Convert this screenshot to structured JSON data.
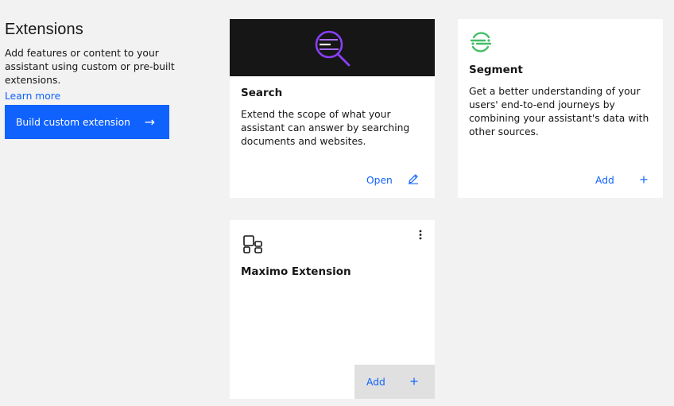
{
  "intro": {
    "title": "Extensions",
    "description": "Add features or content to your assistant using custom or pre-built extensions.",
    "learn_more": "Learn more",
    "build_button": "Build custom extension",
    "build_button_icon": "arrow-right-icon"
  },
  "cards": {
    "search": {
      "title": "Search",
      "description": "Extend the scope of what your assistant can answer by searching documents and websites.",
      "action_label": "Open",
      "action_icon": "edit-icon",
      "icon": "search-magnifier-icon"
    },
    "segment": {
      "title": "Segment",
      "description": "Get a better understanding of your users' end-to-end journeys by combining your assistant's data with other sources.",
      "action_label": "Add",
      "action_icon": "plus-icon",
      "icon": "segment-logo-icon"
    },
    "maximo": {
      "title": "Maximo Extension",
      "action_label": "Add",
      "action_icon": "plus-icon",
      "icon": "apps-icon",
      "menu_icon": "overflow-menu-icon"
    }
  },
  "colors": {
    "primary": "#0f62fe",
    "background": "#f2f2f2",
    "card": "#ffffff",
    "banner": "#161616",
    "search_icon": "#8a3ffc",
    "segment_green": "#42be65"
  }
}
